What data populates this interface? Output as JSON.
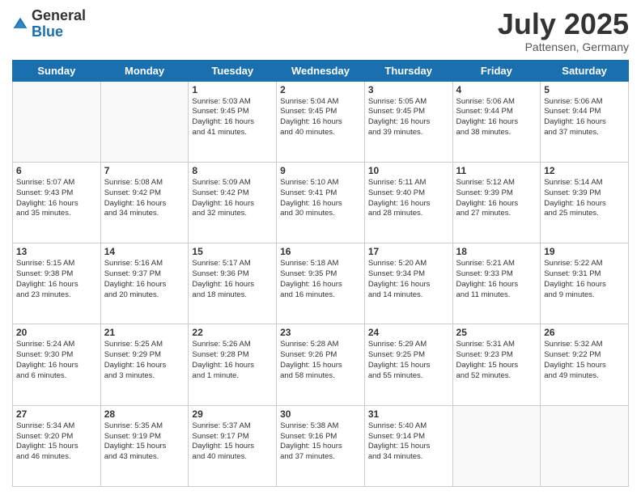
{
  "logo": {
    "general": "General",
    "blue": "Blue"
  },
  "title": "July 2025",
  "subtitle": "Pattensen, Germany",
  "days_header": [
    "Sunday",
    "Monday",
    "Tuesday",
    "Wednesday",
    "Thursday",
    "Friday",
    "Saturday"
  ],
  "weeks": [
    [
      {
        "day": "",
        "info": ""
      },
      {
        "day": "",
        "info": ""
      },
      {
        "day": "1",
        "info": "Sunrise: 5:03 AM\nSunset: 9:45 PM\nDaylight: 16 hours\nand 41 minutes."
      },
      {
        "day": "2",
        "info": "Sunrise: 5:04 AM\nSunset: 9:45 PM\nDaylight: 16 hours\nand 40 minutes."
      },
      {
        "day": "3",
        "info": "Sunrise: 5:05 AM\nSunset: 9:45 PM\nDaylight: 16 hours\nand 39 minutes."
      },
      {
        "day": "4",
        "info": "Sunrise: 5:06 AM\nSunset: 9:44 PM\nDaylight: 16 hours\nand 38 minutes."
      },
      {
        "day": "5",
        "info": "Sunrise: 5:06 AM\nSunset: 9:44 PM\nDaylight: 16 hours\nand 37 minutes."
      }
    ],
    [
      {
        "day": "6",
        "info": "Sunrise: 5:07 AM\nSunset: 9:43 PM\nDaylight: 16 hours\nand 35 minutes."
      },
      {
        "day": "7",
        "info": "Sunrise: 5:08 AM\nSunset: 9:42 PM\nDaylight: 16 hours\nand 34 minutes."
      },
      {
        "day": "8",
        "info": "Sunrise: 5:09 AM\nSunset: 9:42 PM\nDaylight: 16 hours\nand 32 minutes."
      },
      {
        "day": "9",
        "info": "Sunrise: 5:10 AM\nSunset: 9:41 PM\nDaylight: 16 hours\nand 30 minutes."
      },
      {
        "day": "10",
        "info": "Sunrise: 5:11 AM\nSunset: 9:40 PM\nDaylight: 16 hours\nand 28 minutes."
      },
      {
        "day": "11",
        "info": "Sunrise: 5:12 AM\nSunset: 9:39 PM\nDaylight: 16 hours\nand 27 minutes."
      },
      {
        "day": "12",
        "info": "Sunrise: 5:14 AM\nSunset: 9:39 PM\nDaylight: 16 hours\nand 25 minutes."
      }
    ],
    [
      {
        "day": "13",
        "info": "Sunrise: 5:15 AM\nSunset: 9:38 PM\nDaylight: 16 hours\nand 23 minutes."
      },
      {
        "day": "14",
        "info": "Sunrise: 5:16 AM\nSunset: 9:37 PM\nDaylight: 16 hours\nand 20 minutes."
      },
      {
        "day": "15",
        "info": "Sunrise: 5:17 AM\nSunset: 9:36 PM\nDaylight: 16 hours\nand 18 minutes."
      },
      {
        "day": "16",
        "info": "Sunrise: 5:18 AM\nSunset: 9:35 PM\nDaylight: 16 hours\nand 16 minutes."
      },
      {
        "day": "17",
        "info": "Sunrise: 5:20 AM\nSunset: 9:34 PM\nDaylight: 16 hours\nand 14 minutes."
      },
      {
        "day": "18",
        "info": "Sunrise: 5:21 AM\nSunset: 9:33 PM\nDaylight: 16 hours\nand 11 minutes."
      },
      {
        "day": "19",
        "info": "Sunrise: 5:22 AM\nSunset: 9:31 PM\nDaylight: 16 hours\nand 9 minutes."
      }
    ],
    [
      {
        "day": "20",
        "info": "Sunrise: 5:24 AM\nSunset: 9:30 PM\nDaylight: 16 hours\nand 6 minutes."
      },
      {
        "day": "21",
        "info": "Sunrise: 5:25 AM\nSunset: 9:29 PM\nDaylight: 16 hours\nand 3 minutes."
      },
      {
        "day": "22",
        "info": "Sunrise: 5:26 AM\nSunset: 9:28 PM\nDaylight: 16 hours\nand 1 minute."
      },
      {
        "day": "23",
        "info": "Sunrise: 5:28 AM\nSunset: 9:26 PM\nDaylight: 15 hours\nand 58 minutes."
      },
      {
        "day": "24",
        "info": "Sunrise: 5:29 AM\nSunset: 9:25 PM\nDaylight: 15 hours\nand 55 minutes."
      },
      {
        "day": "25",
        "info": "Sunrise: 5:31 AM\nSunset: 9:23 PM\nDaylight: 15 hours\nand 52 minutes."
      },
      {
        "day": "26",
        "info": "Sunrise: 5:32 AM\nSunset: 9:22 PM\nDaylight: 15 hours\nand 49 minutes."
      }
    ],
    [
      {
        "day": "27",
        "info": "Sunrise: 5:34 AM\nSunset: 9:20 PM\nDaylight: 15 hours\nand 46 minutes."
      },
      {
        "day": "28",
        "info": "Sunrise: 5:35 AM\nSunset: 9:19 PM\nDaylight: 15 hours\nand 43 minutes."
      },
      {
        "day": "29",
        "info": "Sunrise: 5:37 AM\nSunset: 9:17 PM\nDaylight: 15 hours\nand 40 minutes."
      },
      {
        "day": "30",
        "info": "Sunrise: 5:38 AM\nSunset: 9:16 PM\nDaylight: 15 hours\nand 37 minutes."
      },
      {
        "day": "31",
        "info": "Sunrise: 5:40 AM\nSunset: 9:14 PM\nDaylight: 15 hours\nand 34 minutes."
      },
      {
        "day": "",
        "info": ""
      },
      {
        "day": "",
        "info": ""
      }
    ]
  ]
}
